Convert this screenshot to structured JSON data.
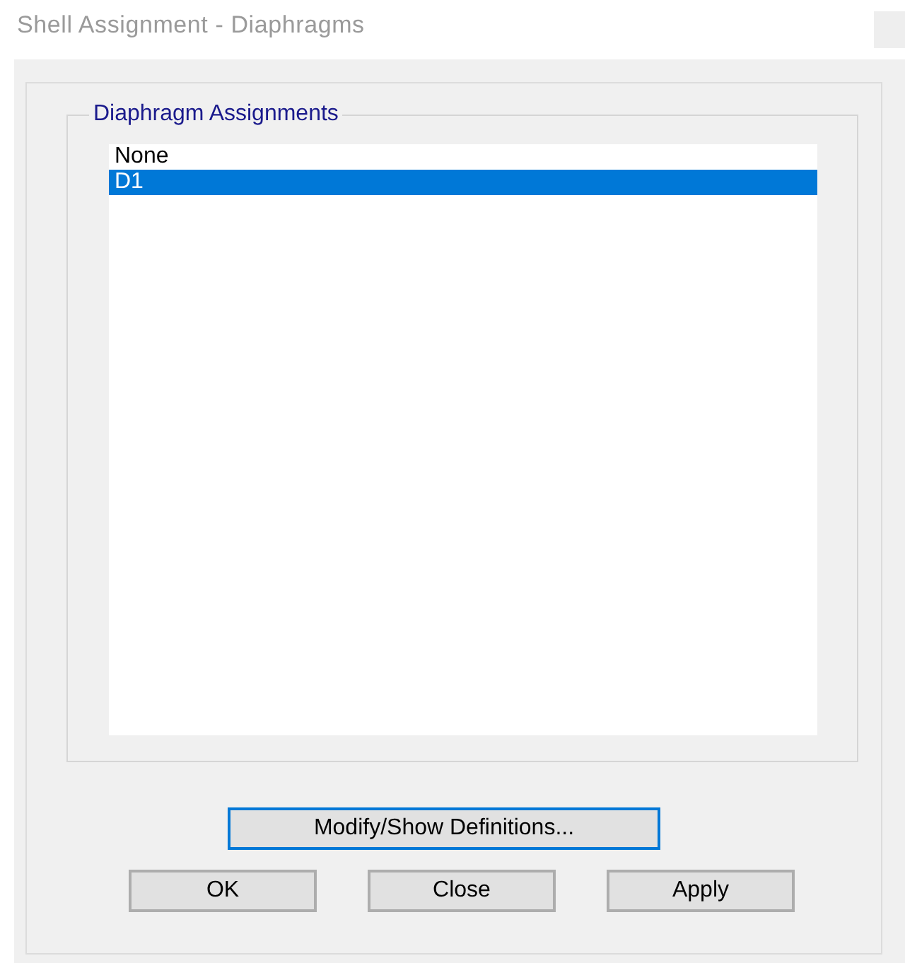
{
  "window": {
    "title": "Shell Assignment - Diaphragms"
  },
  "group": {
    "title": "Diaphragm Assignments",
    "items": [
      {
        "label": "None",
        "selected": false
      },
      {
        "label": "D1",
        "selected": true
      }
    ]
  },
  "definitions_button": {
    "label": "Modify/Show Definitions...",
    "focused": true
  },
  "buttons": [
    "OK",
    "Close",
    "Apply"
  ]
}
